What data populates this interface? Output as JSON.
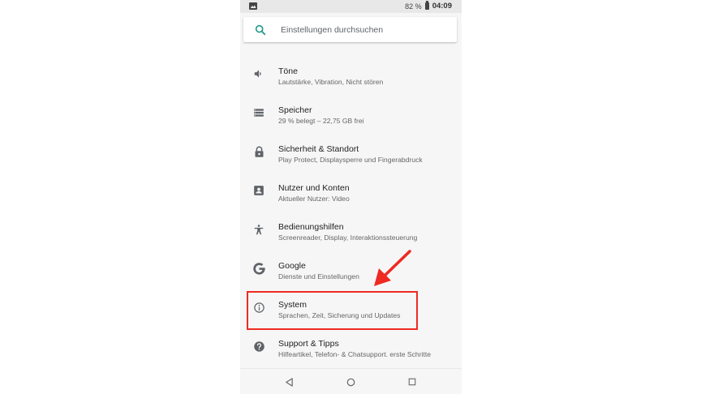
{
  "statusbar": {
    "battery": "82 %",
    "time": "04:09"
  },
  "search": {
    "placeholder": "Einstellungen durchsuchen"
  },
  "settings": [
    {
      "title": "Töne",
      "subtitle": "Lautstärke, Vibration, Nicht stören",
      "icon": "volume-icon"
    },
    {
      "title": "Speicher",
      "subtitle": "29 % belegt – 22,75 GB frei",
      "icon": "storage-icon"
    },
    {
      "title": "Sicherheit & Standort",
      "subtitle": "Play Protect, Displaysperre und Fingerabdruck",
      "icon": "lock-icon"
    },
    {
      "title": "Nutzer und Konten",
      "subtitle": "Aktueller Nutzer: Video",
      "icon": "account-icon"
    },
    {
      "title": "Bedienungshilfen",
      "subtitle": "Screenreader, Display, Interaktionssteuerung",
      "icon": "accessibility-icon"
    },
    {
      "title": "Google",
      "subtitle": "Dienste und Einstellungen",
      "icon": "google-icon"
    },
    {
      "title": "System",
      "subtitle": "Sprachen, Zeit, Sicherung und Updates",
      "icon": "info-icon"
    },
    {
      "title": "Support & Tipps",
      "subtitle": "Hilfeartikel, Telefon- & Chatsupport. erste Schritte",
      "icon": "help-icon"
    }
  ],
  "colors": {
    "accent": "#1a9a8a",
    "highlight": "#ee2a22",
    "icon": "#5f6368"
  }
}
